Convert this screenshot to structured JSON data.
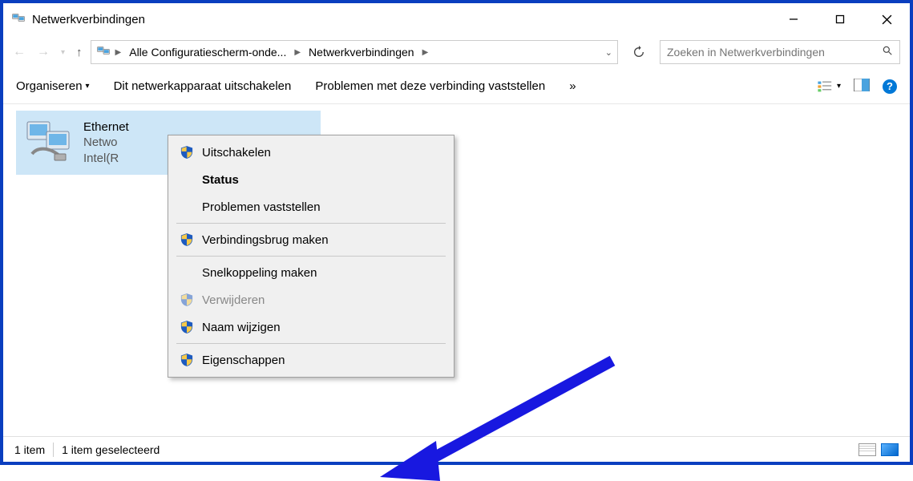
{
  "title": "Netwerkverbindingen",
  "breadcrumb": {
    "item1": "Alle Configuratiescherm-onde...",
    "item2": "Netwerkverbindingen"
  },
  "search": {
    "placeholder": "Zoeken in Netwerkverbindingen"
  },
  "toolbar": {
    "organize": "Organiseren",
    "disable_device": "Dit netwerkapparaat uitschakelen",
    "diagnose": "Problemen met deze verbinding vaststellen",
    "overflow": "»"
  },
  "connection": {
    "name": "Ethernet",
    "line2": "Netwo",
    "line3": "Intel(R"
  },
  "context_menu": {
    "disable": "Uitschakelen",
    "status": "Status",
    "diagnose": "Problemen vaststellen",
    "bridge": "Verbindingsbrug maken",
    "shortcut": "Snelkoppeling maken",
    "delete": "Verwijderen",
    "rename": "Naam wijzigen",
    "properties": "Eigenschappen"
  },
  "statusbar": {
    "items": "1 item",
    "selected": "1 item geselecteerd"
  }
}
